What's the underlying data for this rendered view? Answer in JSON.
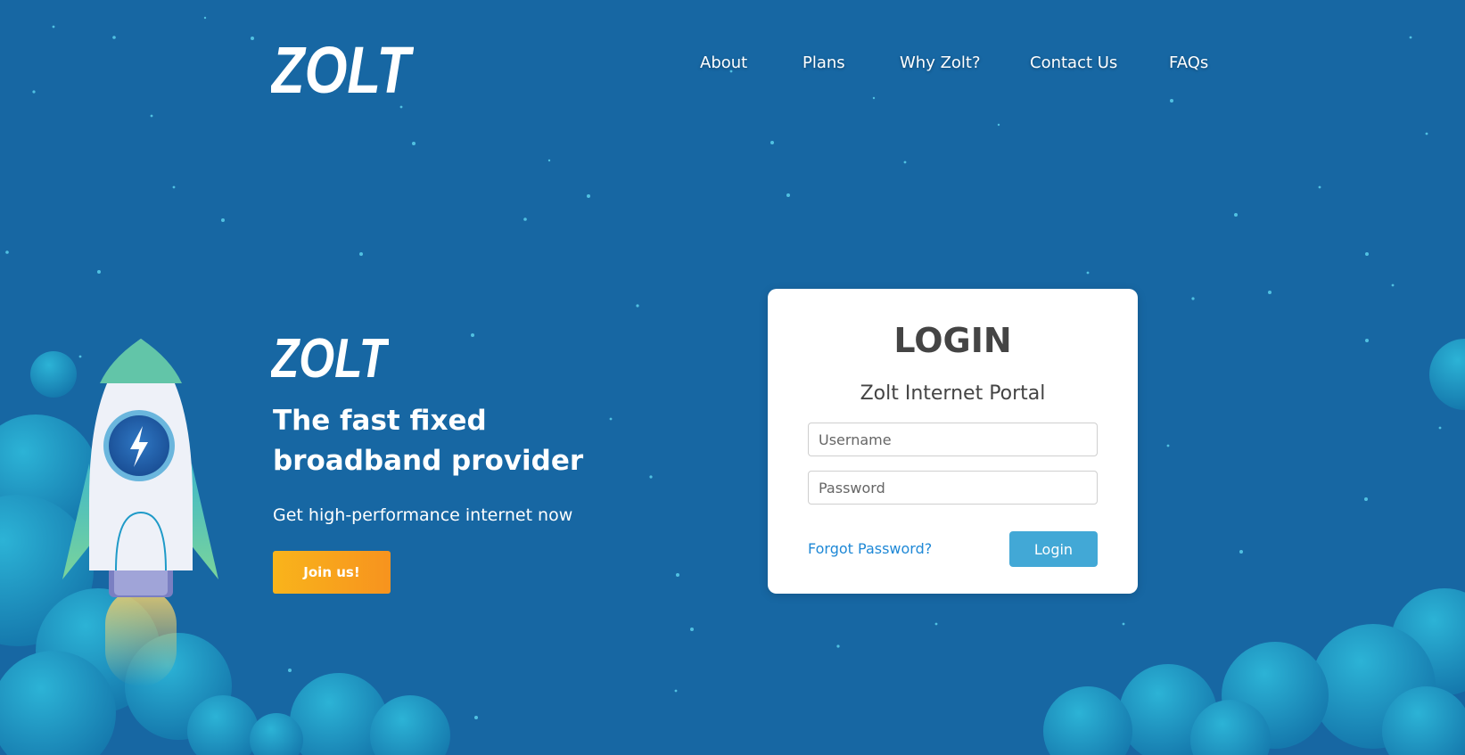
{
  "brand": {
    "name": "ZOLT",
    "logo_icon": "lightning-bolt-icon",
    "colors": {
      "background": "#1767a3",
      "accent": "#f7931e",
      "login_button": "#42a8d6",
      "link": "#1e88d6",
      "cloud": "#1e9ac8"
    }
  },
  "nav": {
    "items": [
      {
        "label": "About"
      },
      {
        "label": "Plans"
      },
      {
        "label": "Why Zolt?"
      },
      {
        "label": "Contact Us"
      },
      {
        "label": "FAQs"
      }
    ]
  },
  "hero": {
    "title": "The fast fixed broadband provider",
    "subtitle": "Get high-performance internet now",
    "cta_label": "Join us!",
    "illustration": "rocket-icon"
  },
  "login": {
    "title": "LOGIN",
    "subtitle": "Zolt Internet Portal",
    "username_placeholder": "Username",
    "password_placeholder": "Password",
    "forgot_label": "Forgot Password?",
    "submit_label": "Login"
  }
}
